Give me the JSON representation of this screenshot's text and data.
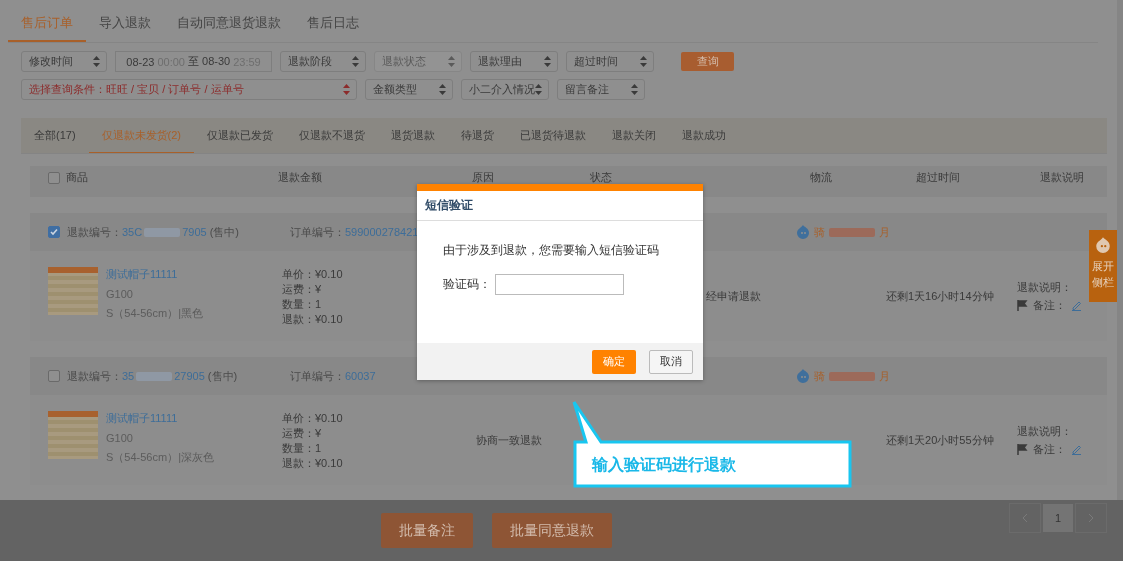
{
  "main_tabs": [
    {
      "label": "售后订单",
      "selected": true
    },
    {
      "label": "导入退款",
      "selected": false
    },
    {
      "label": "自动同意退货退款",
      "selected": false
    },
    {
      "label": "售后日志",
      "selected": false
    }
  ],
  "filter_rows": [
    [
      {
        "kind": "select",
        "label": "修改时间",
        "disabled": false,
        "highlight": false
      },
      {
        "kind": "date_range",
        "start_date": "08-23",
        "start_time": "00:00",
        "separator": "至",
        "end_date": "08-30",
        "end_time": "23:59"
      },
      {
        "kind": "select",
        "label": "退款阶段",
        "disabled": false,
        "highlight": false
      },
      {
        "kind": "select",
        "label": "退款状态",
        "disabled": true,
        "highlight": false
      },
      {
        "kind": "select",
        "label": "退款理由",
        "disabled": false,
        "highlight": false
      },
      {
        "kind": "select",
        "label": "超过时间",
        "disabled": false,
        "highlight": false
      },
      {
        "kind": "button",
        "label": "查询"
      }
    ],
    [
      {
        "kind": "select",
        "label": "选择查询条件：旺旺 / 宝贝 / 订单号 / 运单号",
        "disabled": false,
        "highlight": true
      },
      {
        "kind": "select",
        "label": "金额类型",
        "disabled": false,
        "highlight": false
      },
      {
        "kind": "select",
        "label": "小二介入情况",
        "disabled": false,
        "highlight": false
      },
      {
        "kind": "select",
        "label": "留言备注",
        "disabled": false,
        "highlight": false
      }
    ]
  ],
  "status_tabs": [
    {
      "label": "全部(17)",
      "selected": false
    },
    {
      "label": "仅退款未发货(2)",
      "selected": true
    },
    {
      "label": "仅退款已发货",
      "selected": false
    },
    {
      "label": "仅退款不退货",
      "selected": false
    },
    {
      "label": "退货退款",
      "selected": false
    },
    {
      "label": "待退货",
      "selected": false
    },
    {
      "label": "已退货待退款",
      "selected": false
    },
    {
      "label": "退款关闭",
      "selected": false
    },
    {
      "label": "退款成功",
      "selected": false
    }
  ],
  "table": {
    "select_all_checked": false,
    "columns": [
      "商品",
      "退款金额",
      "原因",
      "状态",
      "物流",
      "超过时间",
      "退款说明"
    ],
    "orders": [
      {
        "checked": true,
        "refund_no_label": "退款编号：",
        "refund_no_start": "35C",
        "refund_no_end": "7905",
        "sale_state": "(售中)",
        "order_no_label": "订单编号：",
        "order_no": "599000278421",
        "buyer_start": "骑",
        "buyer_end": "月",
        "product_name": "测试帽子11111",
        "sku": "G100",
        "spec": "S（54-56cm）|黑色",
        "amounts": [
          {
            "label": "单价：",
            "value": "¥0.10"
          },
          {
            "label": "运费：",
            "value": "¥"
          },
          {
            "label": "数量：",
            "value": "1"
          },
          {
            "label": "退款：",
            "value": "¥0.10"
          }
        ],
        "status": "经申请退款",
        "overtime": "还剩1天16小时14分钟",
        "explanation_label": "退款说明：",
        "note_label": "备注："
      },
      {
        "checked": false,
        "refund_no_label": "退款编号：",
        "refund_no_start": "35",
        "refund_no_end": "27905",
        "sale_state": "(售中)",
        "order_no_label": "订单编号：",
        "order_no": "60037",
        "buyer_start": "骑",
        "buyer_end": "月",
        "product_name": "测试帽子11111",
        "sku": "G100",
        "spec": "S（54-56cm）|深灰色",
        "amounts": [
          {
            "label": "单价：",
            "value": "¥0.10"
          },
          {
            "label": "运费：",
            "value": "¥"
          },
          {
            "label": "数量：",
            "value": "1"
          },
          {
            "label": "退款：",
            "value": "¥0.10"
          }
        ],
        "reason": "协商一致退款",
        "overtime": "还剩1天20小时55分钟",
        "explanation_label": "退款说明：",
        "note_label": "备注："
      }
    ]
  },
  "side_tab": {
    "label": "展开侧栏"
  },
  "footer": {
    "buttons": [
      "批量备注",
      "批量同意退款"
    ],
    "pages": [
      {
        "label": "1",
        "selected": true
      }
    ]
  },
  "dialog": {
    "title": "短信验证",
    "message": "由于涉及到退款，您需要输入短信验证码",
    "field_label": "验证码：",
    "confirm": "确定",
    "cancel": "取消"
  },
  "callout": {
    "text": "输入验证码进行退款"
  }
}
